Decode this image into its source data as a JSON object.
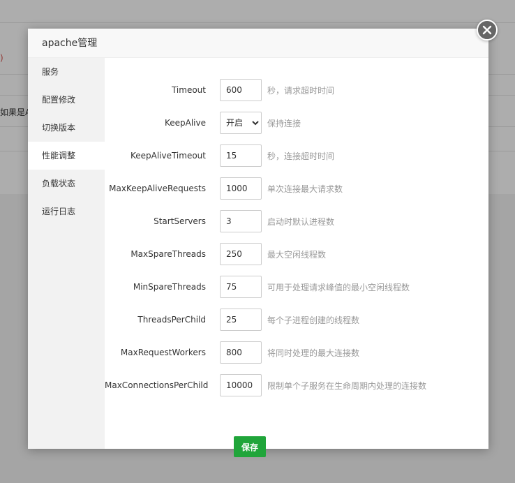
{
  "background": {
    "red_fragment": ")",
    "text_fragment": "如果是A"
  },
  "modal": {
    "title": "apache管理",
    "close_icon": "close-icon"
  },
  "sidebar": {
    "items": [
      {
        "label": "服务",
        "active": false
      },
      {
        "label": "配置修改",
        "active": false
      },
      {
        "label": "切换版本",
        "active": false
      },
      {
        "label": "性能调整",
        "active": true
      },
      {
        "label": "负载状态",
        "active": false
      },
      {
        "label": "运行日志",
        "active": false
      }
    ]
  },
  "form": {
    "rows": [
      {
        "label": "Timeout",
        "value": "600",
        "hint": "秒，请求超时时间"
      },
      {
        "label": "KeepAlive",
        "value": "开启",
        "hint": "保持连接",
        "type": "select"
      },
      {
        "label": "KeepAliveTimeout",
        "value": "15",
        "hint": "秒，连接超时时间"
      },
      {
        "label": "MaxKeepAliveRequests",
        "value": "1000",
        "hint": "单次连接最大请求数"
      },
      {
        "label": "StartServers",
        "value": "3",
        "hint": "启动时默认进程数"
      },
      {
        "label": "MaxSpareThreads",
        "value": "250",
        "hint": "最大空闲线程数"
      },
      {
        "label": "MinSpareThreads",
        "value": "75",
        "hint": "可用于处理请求峰值的最小空闲线程数"
      },
      {
        "label": "ThreadsPerChild",
        "value": "25",
        "hint": "每个子进程创建的线程数"
      },
      {
        "label": "MaxRequestWorkers",
        "value": "800",
        "hint": "将同时处理的最大连接数"
      },
      {
        "label": "MaxConnectionsPerChild",
        "value": "10000",
        "hint": "限制单个子服务在生命周期内处理的连接数"
      }
    ],
    "save_label": "保存"
  },
  "colors": {
    "accent": "#20a53a",
    "hint": "#999999"
  }
}
